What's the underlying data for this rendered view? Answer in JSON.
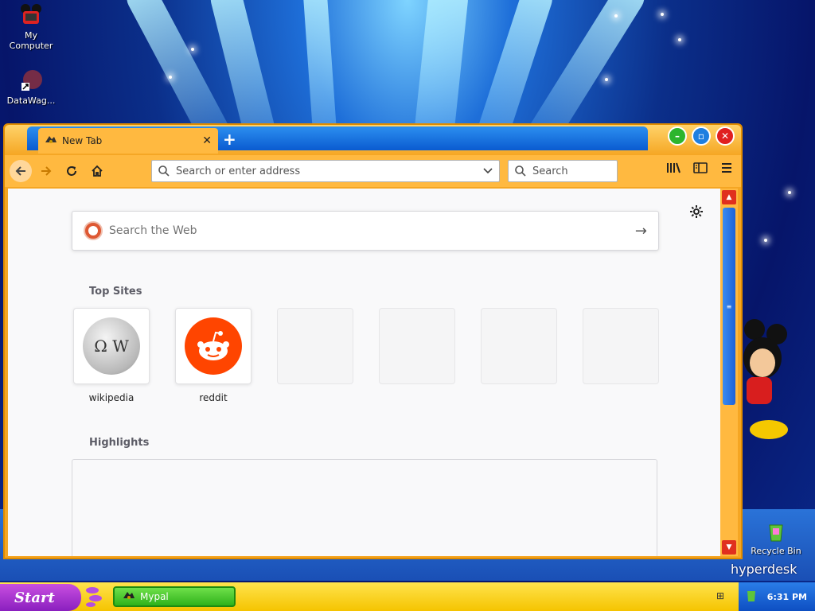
{
  "desktop": {
    "icons": [
      {
        "label": "My\nComputer",
        "icon": "mickey-computer-icon"
      },
      {
        "label": "DataWag...",
        "icon": "shortcut-icon"
      },
      {
        "label": "Recycle Bin",
        "icon": "recycle-bin-icon"
      }
    ],
    "brand": "hyperdesk"
  },
  "browser": {
    "tab": {
      "title": "New Tab",
      "icon": "mypal-icon"
    },
    "address_placeholder": "Search or enter address",
    "search_placeholder": "Search",
    "content": {
      "web_search_placeholder": "Search the Web",
      "top_sites_title": "Top Sites",
      "top_sites": [
        {
          "label": "wikipedia",
          "icon": "wikipedia-icon"
        },
        {
          "label": "reddit",
          "icon": "reddit-icon"
        },
        {
          "label": ""
        },
        {
          "label": ""
        },
        {
          "label": ""
        },
        {
          "label": ""
        }
      ],
      "highlights_title": "Highlights"
    }
  },
  "taskbar": {
    "start_label": "Start",
    "task_label": "Mypal",
    "clock": "6:31 PM"
  },
  "colors": {
    "window_frame": "#f5a623",
    "tabstrip": "#0a5bd0",
    "taskbar": "#f5c400",
    "start": "#8a1fbf"
  }
}
